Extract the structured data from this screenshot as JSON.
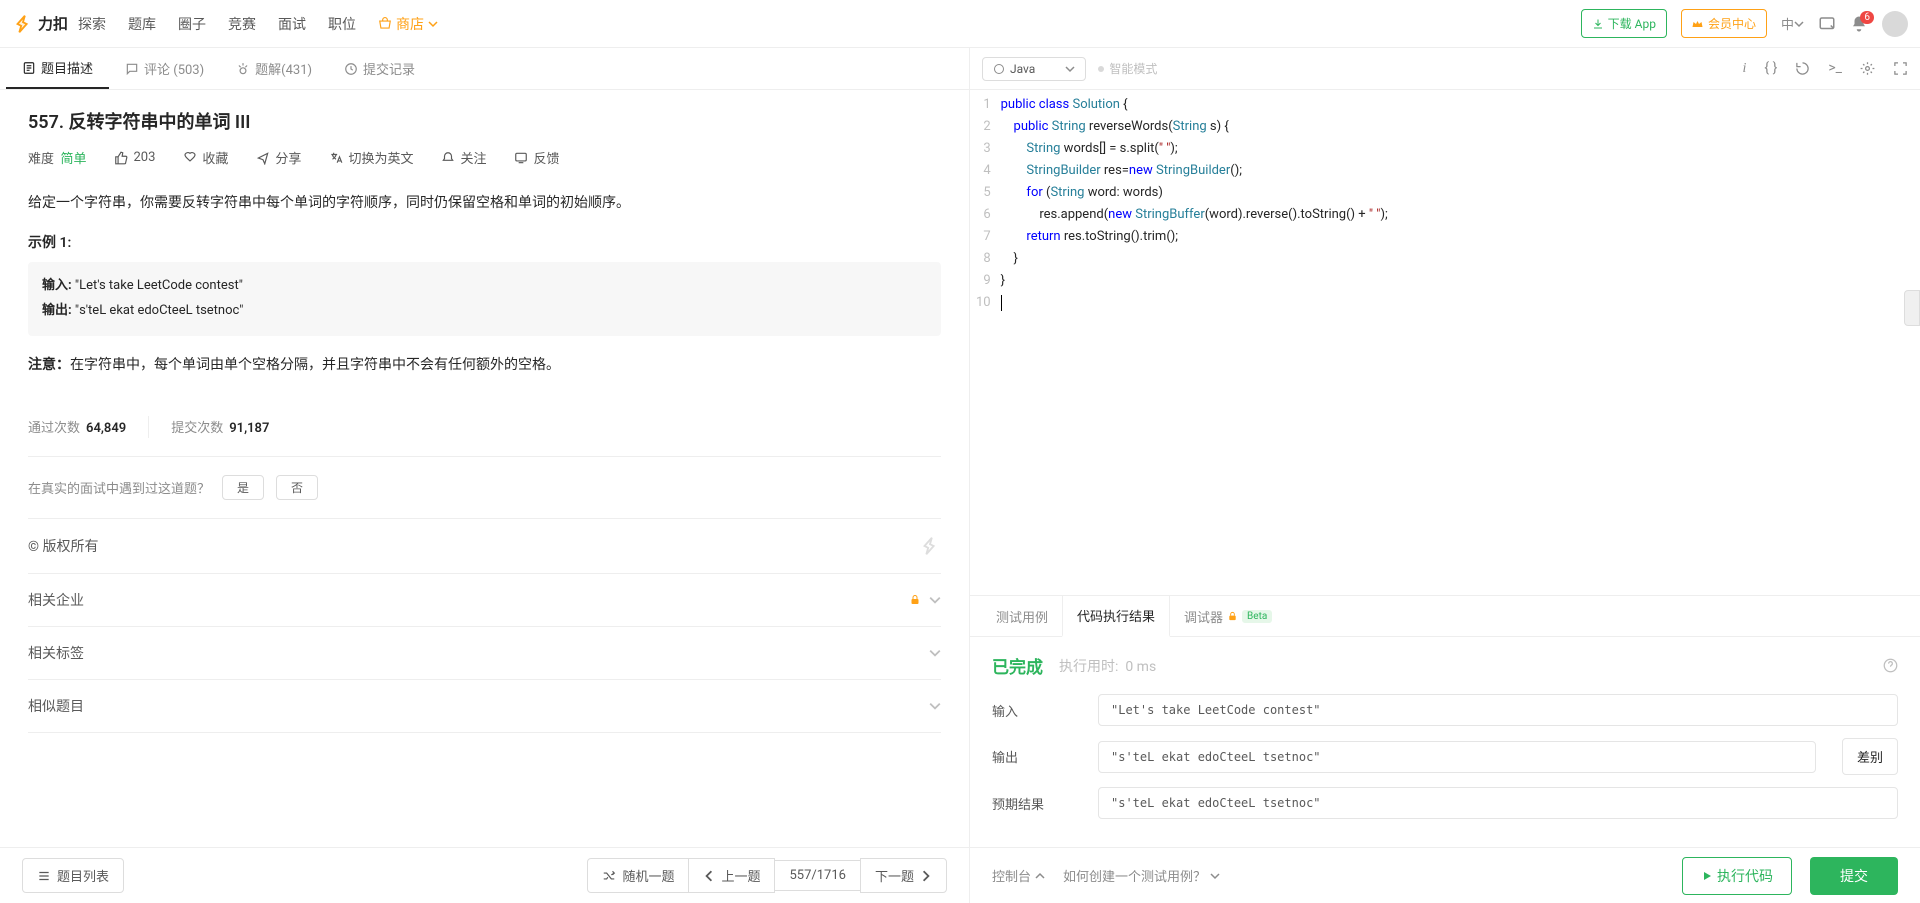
{
  "nav": {
    "brand": "力扣",
    "links": [
      "探索",
      "题库",
      "圈子",
      "竞赛",
      "面试",
      "职位"
    ],
    "shop": "商店",
    "download": "下载 App",
    "member": "会员中心",
    "lang": "中",
    "notif_count": "6"
  },
  "tabs": {
    "desc": "题目描述",
    "comments": "评论 (503)",
    "solutions": "题解(431)",
    "submissions": "提交记录"
  },
  "problem": {
    "title": "557. 反转字符串中的单词 III",
    "diff_label": "难度",
    "diff_value": "简单",
    "like_count": "203",
    "star": "收藏",
    "share": "分享",
    "switch_lang": "切换为英文",
    "follow": "关注",
    "feedback": "反馈",
    "desc_text": "给定一个字符串，你需要反转字符串中每个单词的字符顺序，同时仍保留空格和单词的初始顺序。",
    "example_label": "示例 1:",
    "example_input_label": "输入: ",
    "example_input": "\"Let's take LeetCode contest\"",
    "example_output_label": "输出: ",
    "example_output": "\"s'teL ekat edoCteeL tsetnoc\"",
    "note_label": "注意：",
    "note_text": "在字符串中，每个单词由单个空格分隔，并且字符串中不会有任何额外的空格。",
    "pass_label": "通过次数",
    "pass_count": "64,849",
    "submit_label": "提交次数",
    "submit_count": "91,187",
    "interview_q": "在真实的面试中遇到过这道题？",
    "yes": "是",
    "no": "否",
    "copyright": "© 版权所有",
    "related_company": "相关企业",
    "related_tags": "相关标签",
    "similar": "相似题目"
  },
  "left_footer": {
    "list": "题目列表",
    "random": "随机一题",
    "prev": "上一题",
    "indicator": "557/1716",
    "next": "下一题"
  },
  "editor": {
    "language": "Java",
    "smart": "智能模式",
    "code_tokens": [
      [
        [
          "kw",
          "public"
        ],
        [
          "",
          " "
        ],
        [
          "kw",
          "class"
        ],
        [
          "",
          " "
        ],
        [
          "cls",
          "Solution"
        ],
        [
          "",
          " {"
        ]
      ],
      [
        [
          "",
          "    "
        ],
        [
          "kw",
          "public"
        ],
        [
          "",
          " "
        ],
        [
          "cls",
          "String"
        ],
        [
          "",
          " reverseWords("
        ],
        [
          "cls",
          "String"
        ],
        [
          "",
          " s) {"
        ]
      ],
      [
        [
          "",
          "        "
        ],
        [
          "cls",
          "String"
        ],
        [
          "",
          " words[] = s.split("
        ],
        [
          "str",
          "\" \""
        ],
        [
          "",
          ");"
        ]
      ],
      [
        [
          "",
          "        "
        ],
        [
          "cls",
          "StringBuilder"
        ],
        [
          "",
          " res="
        ],
        [
          "kw",
          "new"
        ],
        [
          "",
          " "
        ],
        [
          "cls",
          "StringBuilder"
        ],
        [
          "",
          "();"
        ]
      ],
      [
        [
          "",
          "        "
        ],
        [
          "kw",
          "for"
        ],
        [
          "",
          " ("
        ],
        [
          "cls",
          "String"
        ],
        [
          "",
          " word: words)"
        ]
      ],
      [
        [
          "",
          "            res.append("
        ],
        [
          "kw",
          "new"
        ],
        [
          "",
          " "
        ],
        [
          "cls",
          "StringBuffer"
        ],
        [
          "",
          "(word).reverse().toString() + "
        ],
        [
          "str",
          "\" \""
        ],
        [
          "",
          ");"
        ]
      ],
      [
        [
          "",
          "        "
        ],
        [
          "kw",
          "return"
        ],
        [
          "",
          " res.toString().trim();"
        ]
      ],
      [
        [
          "",
          "    }"
        ]
      ],
      [
        [
          "",
          "}"
        ]
      ],
      [
        [
          "",
          ""
        ]
      ]
    ]
  },
  "result_tabs": {
    "testcase": "测试用例",
    "output": "代码执行结果",
    "debugger": "调试器",
    "beta": "Beta"
  },
  "result": {
    "status": "已完成",
    "time_label": "执行用时:",
    "time_value": "0 ms",
    "input_label": "输入",
    "input": "\"Let's take LeetCode contest\"",
    "output_label": "输出",
    "output": "\"s'teL ekat edoCteeL tsetnoc\"",
    "expected_label": "预期结果",
    "expected": "\"s'teL ekat edoCteeL tsetnoc\"",
    "diff": "差别"
  },
  "right_footer": {
    "console": "控制台",
    "how_to": "如何创建一个测试用例？",
    "run": "执行代码",
    "submit": "提交"
  }
}
